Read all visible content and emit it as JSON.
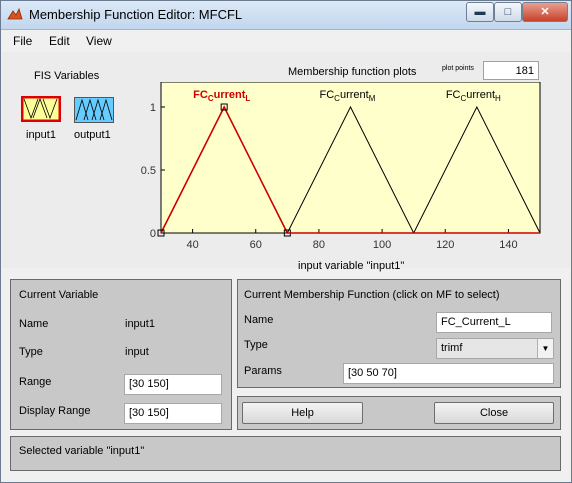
{
  "window": {
    "title": "Membership Function Editor: MFCFL"
  },
  "menu": {
    "file": "File",
    "edit": "Edit",
    "view": "View"
  },
  "fis": {
    "label": "FIS Variables",
    "input_name": "input1",
    "output_name": "output1"
  },
  "plot": {
    "title": "Membership function plots",
    "plot_points_label": "plot points",
    "plot_points": "181",
    "xlabel": "input variable \"input1\""
  },
  "chart_data": {
    "type": "line",
    "title": "Membership function plots",
    "xlabel": "input variable \"input1\"",
    "ylabel": "",
    "xlim": [
      30,
      150
    ],
    "ylim": [
      0,
      1
    ],
    "x_ticks": [
      "40",
      "60",
      "80",
      "100",
      "120",
      "140"
    ],
    "y_ticks": [
      "0",
      "0.5",
      "1"
    ],
    "series": [
      {
        "name": "FC_current_L",
        "label_base": "FC",
        "label_sub": "C",
        "label_mid": "urrent",
        "label_end": "L",
        "x": [
          30,
          50,
          70
        ],
        "y": [
          0,
          1,
          0
        ],
        "color": "#cc0000",
        "selected": true
      },
      {
        "name": "FC_current_M",
        "label_base": "FC",
        "label_sub": "C",
        "label_mid": "urrent",
        "label_end": "M",
        "x": [
          70,
          90,
          110
        ],
        "y": [
          0,
          1,
          0
        ],
        "color": "#000000",
        "selected": false
      },
      {
        "name": "FC_current_H",
        "label_base": "FC",
        "label_sub": "C",
        "label_mid": "urrent",
        "label_end": "H",
        "x": [
          110,
          130,
          150
        ],
        "y": [
          0,
          1,
          0
        ],
        "color": "#000000",
        "selected": false
      }
    ],
    "background": "#ffffcc"
  },
  "current_variable": {
    "header": "Current Variable",
    "name_label": "Name",
    "name_value": "input1",
    "type_label": "Type",
    "type_value": "input",
    "range_label": "Range",
    "range_value": "[30 150]",
    "display_range_label": "Display Range",
    "display_range_value": "[30 150]"
  },
  "current_mf": {
    "header": "Current Membership Function (click on MF to select)",
    "name_label": "Name",
    "name_value": "FC_Current_L",
    "type_label": "Type",
    "type_value": "trimf",
    "params_label": "Params",
    "params_value": "[30 50 70]"
  },
  "buttons": {
    "help": "Help",
    "close": "Close"
  },
  "status": {
    "text": "Selected variable \"input1\""
  },
  "colors": {
    "selected_border": "#e00000",
    "input_icon_fill": "#ffff99",
    "output_icon_fill": "#66ccff"
  }
}
